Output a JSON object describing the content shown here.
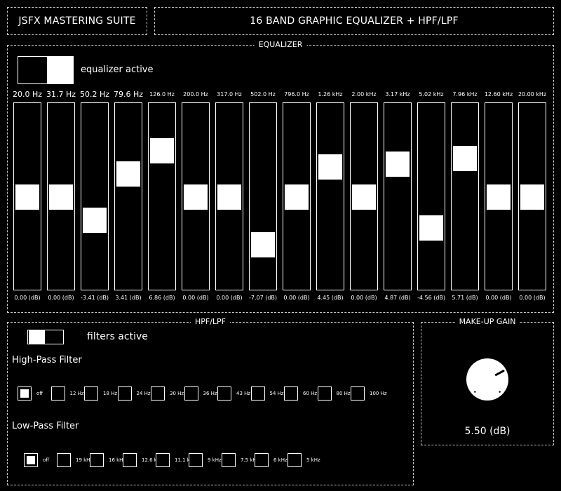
{
  "header": {
    "suite_title": "JSFX MASTERING SUITE",
    "plugin_title": "16 BAND GRAPHIC EQUALIZER + HPF/LPF"
  },
  "equalizer": {
    "section_title": "EQUALIZER",
    "toggle_label": "equalizer active",
    "active": true,
    "bands": [
      {
        "freq": "20.0 Hz",
        "gain": "0.00 (dB)",
        "gain_db": 0.0
      },
      {
        "freq": "31.7 Hz",
        "gain": "0.00 (dB)",
        "gain_db": 0.0
      },
      {
        "freq": "50.2 Hz",
        "gain": "-3.41 (dB)",
        "gain_db": -3.41
      },
      {
        "freq": "79.6 Hz",
        "gain": "3.41 (dB)",
        "gain_db": 3.41
      },
      {
        "freq": "126.0 Hz",
        "gain": "6.86 (dB)",
        "gain_db": 6.86
      },
      {
        "freq": "200.0 Hz",
        "gain": "0.00 (dB)",
        "gain_db": 0.0
      },
      {
        "freq": "317.0 Hz",
        "gain": "0.00 (dB)",
        "gain_db": 0.0
      },
      {
        "freq": "502.0 Hz",
        "gain": "-7.07 (dB)",
        "gain_db": -7.07
      },
      {
        "freq": "796.0 Hz",
        "gain": "0.00 (dB)",
        "gain_db": 0.0
      },
      {
        "freq": "1.26 kHz",
        "gain": "4.45 (dB)",
        "gain_db": 4.45
      },
      {
        "freq": "2.00 kHz",
        "gain": "0.00 (dB)",
        "gain_db": 0.0
      },
      {
        "freq": "3.17 kHz",
        "gain": "4.87 (dB)",
        "gain_db": 4.87
      },
      {
        "freq": "5.02 kHz",
        "gain": "-4.56 (dB)",
        "gain_db": -4.56
      },
      {
        "freq": "7.96 kHz",
        "gain": "5.71 (dB)",
        "gain_db": 5.71
      },
      {
        "freq": "12.60 kHz",
        "gain": "0.00 (dB)",
        "gain_db": 0.0
      },
      {
        "freq": "20.00 kHz",
        "gain": "0.00 (dB)",
        "gain_db": 0.0
      }
    ]
  },
  "filters": {
    "section_title": "HPF/LPF",
    "toggle_label": "filters active",
    "active": false,
    "hpf": {
      "title": "High-Pass Filter",
      "selected": 0,
      "options": [
        "off",
        "12 Hz",
        "18 Hz",
        "24 Hz",
        "30 Hz",
        "36 Hz",
        "43 Hz",
        "54 Hz",
        "60 Hz",
        "80 Hz",
        "100 Hz"
      ]
    },
    "lpf": {
      "title": "Low-Pass Filter",
      "selected": 0,
      "options": [
        "off",
        "19 kHz",
        "16 kHz",
        "12.6 kHz",
        "11.1 kHz",
        "9 kHz",
        "7.5 kHz",
        "6 kHz",
        "5 kHz"
      ]
    }
  },
  "makeup": {
    "section_title": "MAKE-UP GAIN",
    "value_text": "5.50 (dB)",
    "value_db": 5.5
  }
}
